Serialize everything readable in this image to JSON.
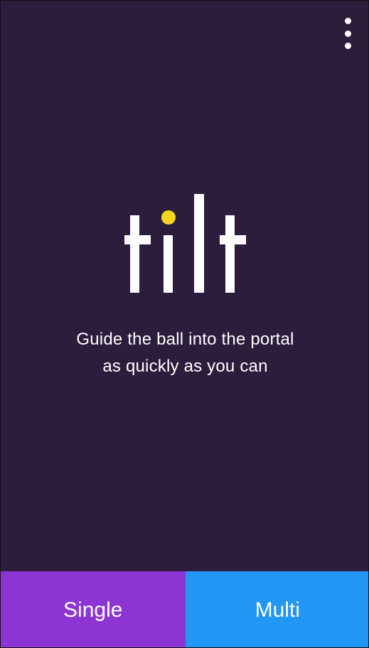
{
  "app": {
    "logo_text": "tilt",
    "logo_icon": "tilt-logo-icon",
    "ball_color": "#f9d523",
    "background_color": "#2d1d3c"
  },
  "menu": {
    "icon": "more-vertical-icon"
  },
  "tagline": {
    "line1": "Guide the ball into the portal",
    "line2": "as quickly as you can"
  },
  "buttons": {
    "single_label": "Single",
    "single_color": "#8c35d3",
    "multi_label": "Multi",
    "multi_color": "#2196f3"
  }
}
